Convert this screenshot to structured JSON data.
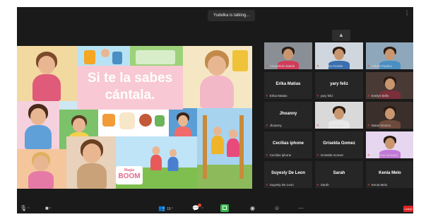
{
  "meeting": {
    "talking_indicator": "Yudelka is talking..."
  },
  "shared_screen": {
    "title_text": "Si te la sabes cántala.",
    "logo_top": "Magia",
    "logo_bottom": "BOOM"
  },
  "participants": [
    {
      "display": "",
      "label": "Anandridin Batida",
      "video": true,
      "shirt": "#d23c5a",
      "bg": "#8a8f96"
    },
    {
      "display": "",
      "label": "Yudelka Peralta",
      "video": true,
      "shirt": "#3a6fb0",
      "bg": "#cfd6de"
    },
    {
      "display": "",
      "label": "Yubert Paulino",
      "video": true,
      "shirt": "#4a90c2",
      "bg": "#8fa7bb"
    },
    {
      "display": "Erika Matias",
      "label": "Erika Matias",
      "video": false
    },
    {
      "display": "yary feliz",
      "label": "yary feliz",
      "video": false
    },
    {
      "display": "",
      "label": "Evelyn Bello",
      "video": true,
      "shirt": "#7a2f3a",
      "bg": "#4a3a36"
    },
    {
      "display": "Jhoanny",
      "label": "Jhoanny",
      "video": false
    },
    {
      "display": "",
      "label": "Yubeth Martinez",
      "video": true,
      "shirt": "#e8e8e8",
      "bg": "#d9d9d9"
    },
    {
      "display": "",
      "label": "Diana Orozco",
      "video": true,
      "shirt": "#6d4a3c",
      "bg": "#3b2f2b"
    },
    {
      "display": "Cecilias iphone",
      "label": "Cecilias iphone",
      "video": false
    },
    {
      "display": "Griselda Gomez",
      "label": "Griselda Gomez",
      "video": false
    },
    {
      "display": "",
      "label": "Catherine Leonard",
      "video": true,
      "shirt": "#c278d6",
      "bg": "#e6d6ef"
    },
    {
      "display": "Suyesly De Leon",
      "label": "Suyesly De Leon",
      "video": false
    },
    {
      "display": "Sarah",
      "label": "Sarah",
      "video": false
    },
    {
      "display": "Kenia Melo",
      "label": "Kenia Melo",
      "video": false
    }
  ],
  "toolbar": {
    "collapse_icon": "chevron-up-icon",
    "mic_icon": "mic-icon",
    "video_icon": "video-camera-icon",
    "participants_icon": "participants-icon",
    "participants_count": "15",
    "chat_icon": "chat-icon",
    "share_icon": "share-screen-icon",
    "record_icon": "record-icon",
    "reactions_icon": "reactions-icon",
    "more_icon": "more-icon",
    "leave_label": "Leave"
  },
  "colors": {
    "background": "#1a1a1a",
    "tile": "#262626",
    "share_green": "#35b34a",
    "leave_red": "#e02424",
    "title_card_pink": "#f8c8d4",
    "muted_red": "#e4473b"
  }
}
